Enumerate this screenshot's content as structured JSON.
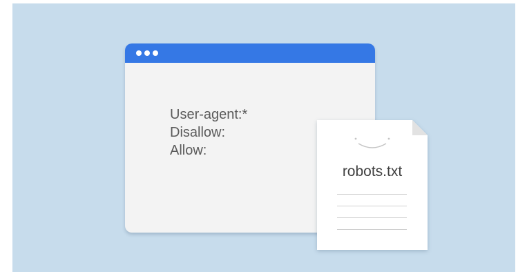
{
  "window": {
    "lines": [
      "User-agent:*",
      "Disallow:",
      "Allow:"
    ]
  },
  "document": {
    "filename": "robots.txt"
  },
  "colors": {
    "background": "#c7dcec",
    "titlebar": "#3578e5",
    "window": "#f3f3f3",
    "paper": "#ffffff"
  },
  "icons": [
    "window-dots-icon",
    "smile-icon",
    "document-icon"
  ]
}
